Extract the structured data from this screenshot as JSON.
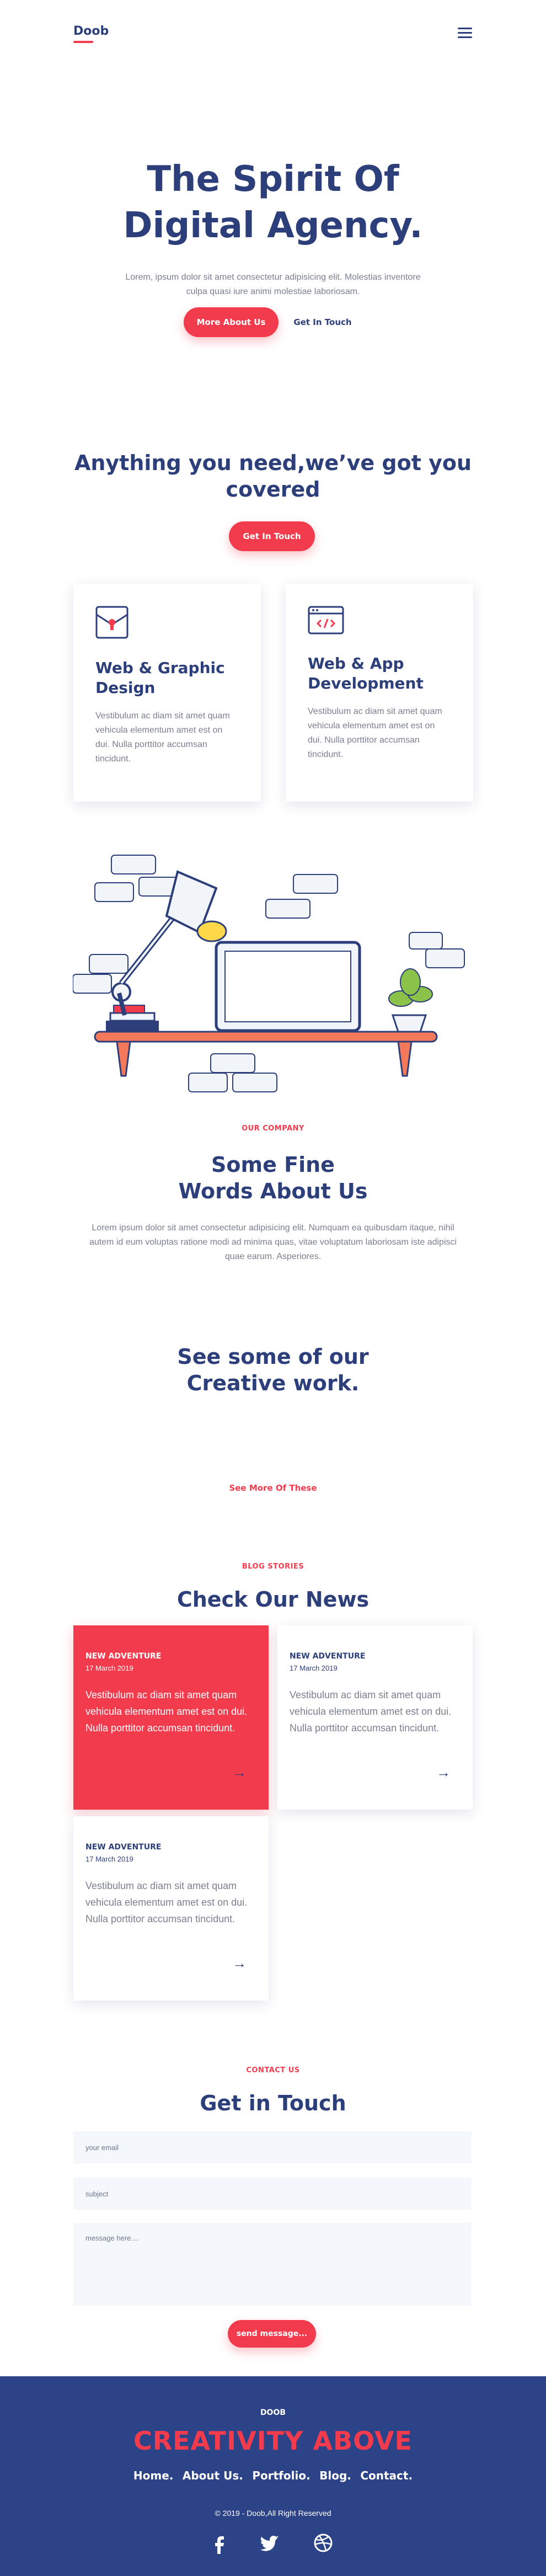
{
  "header": {
    "logo": "Doob"
  },
  "hero": {
    "title_line1": "The Spirit Of",
    "title_line2": "Digital Agency.",
    "description": "Lorem, ipsum dolor sit amet consectetur adipisicing elit. Molestias inventore culpa quasi iure animi molestiae laboriosam.",
    "primary_button": "More About Us",
    "secondary_link": "Get In Touch"
  },
  "services": {
    "title_line1": "Anything you need,we’ve got you",
    "title_line2": "covered",
    "button": "Get In Touch",
    "cards": [
      {
        "title": "Web & Graphic Design",
        "text": "Vestibulum ac diam sit amet quam vehicula elementum amet est on dui. Nulla porttitor accumsan tincidunt."
      },
      {
        "title": "Web & App Development",
        "text": "Vestibulum ac diam sit amet quam vehicula elementum amet est on dui. Nulla porttitor accumsan tincidunt."
      }
    ]
  },
  "about": {
    "eyebrow": "OUR COMPANY",
    "title_line1": "Some Fine",
    "title_line2": "Words About Us",
    "text": "Lorem ipsum dolor sit amet consectetur adipisicing elit. Numquam ea quibusdam itaque, nihil autem id eum voluptas ratione modi ad minima quas, vitae voluptatum laboriosam iste adipisci quae earum. Asperiores."
  },
  "work": {
    "title_line1": "See some of our",
    "title_line2": "Creative work.",
    "link": "See More Of These"
  },
  "blog": {
    "eyebrow": "BLOG STORIES",
    "title": "Check Our News",
    "cards": [
      {
        "tag": "NEW ADVENTURE",
        "date": "17 March 2019",
        "text": "Vestibulum ac diam sit amet quam vehicula elementum amet est on dui. Nulla porttitor accumsan tincidunt.",
        "arrow": "→"
      },
      {
        "tag": "NEW ADVENTURE",
        "date": "17 March 2019",
        "text": "Vestibulum ac diam sit amet quam vehicula elementum amet est on dui. Nulla porttitor accumsan tincidunt.",
        "arrow": "→"
      },
      {
        "tag": "NEW ADVENTURE",
        "date": "17 March 2019",
        "text": "Vestibulum ac diam sit amet quam vehicula elementum amet est on dui. Nulla porttitor accumsan tincidunt.",
        "arrow": "→"
      }
    ]
  },
  "contact": {
    "eyebrow": "CONTACT US",
    "title": "Get in Touch",
    "email_placeholder": "your email",
    "subject_placeholder": "subject",
    "message_placeholder": "message here....",
    "send_button": "send message..."
  },
  "footer": {
    "brand": "DOOB",
    "tagline": "CREATIVITY ABOVE",
    "nav": [
      "Home.",
      "About Us.",
      "Portfolio.",
      "Blog.",
      "Contact."
    ],
    "copyright": "© 2019 - Doob,All Right Reserved",
    "social_icons": [
      "facebook-icon",
      "twitter-icon",
      "dribbble-icon"
    ]
  },
  "colors": {
    "navy": "#2d3f7b",
    "accent": "#f33b4e",
    "footer_bg": "#2d4387",
    "muted_text": "#7b7f91"
  }
}
